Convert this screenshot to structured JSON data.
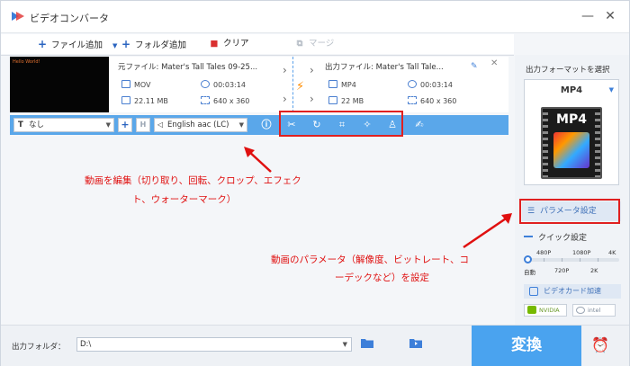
{
  "window": {
    "title": "ビデオコンバータ",
    "minimize": "—",
    "close": "✕"
  },
  "toolbar": {
    "add_file": "ファイル追加",
    "add_folder": "フォルダ追加",
    "clear": "クリア",
    "merge": "マージ"
  },
  "file": {
    "thumbnail_text": "Hello World!",
    "source_name": "元ファイル: Mater's Tall Tales 09-25...",
    "source_format": "MOV",
    "source_duration": "00:03:14",
    "source_size": "22.11 MB",
    "source_resolution": "640 x 360",
    "output_name": "出力ファイル: Mater's Tall Tale...",
    "output_format": "MP4",
    "output_duration": "00:03:14",
    "output_size": "22 MB",
    "output_resolution": "640 x 360"
  },
  "editbar": {
    "subtitle_value": "なし",
    "audio_value": "English aac (LC)"
  },
  "annotations": {
    "edit_line1": "動画を編集（切り取り、回転、クロップ、エフェク",
    "edit_line2": "ト、ウォーターマーク）",
    "param_line1": "動画のパラメータ（解像度、ビットレート、コ",
    "param_line2": "ーデックなど）を設定"
  },
  "right_panel": {
    "select_label": "出力フォーマットを選択",
    "format_name": "MP4",
    "format_icon_label": "MP4",
    "param_button": "パラメータ設定",
    "quick_label": "クイック設定",
    "q_480": "480P",
    "q_1080": "1080P",
    "q_4k": "4K",
    "q_auto": "自動",
    "q_720": "720P",
    "q_2k": "2K",
    "gpu_label": "ビデオカード加速",
    "vendor_nvidia": "NVIDIA",
    "vendor_intel": "intel"
  },
  "bottom": {
    "output_folder_label": "出力フォルダ：",
    "output_path": "D:\\",
    "convert_label": "変換"
  },
  "colors": {
    "accent": "#4aa3ef",
    "annotation": "#e01010"
  }
}
